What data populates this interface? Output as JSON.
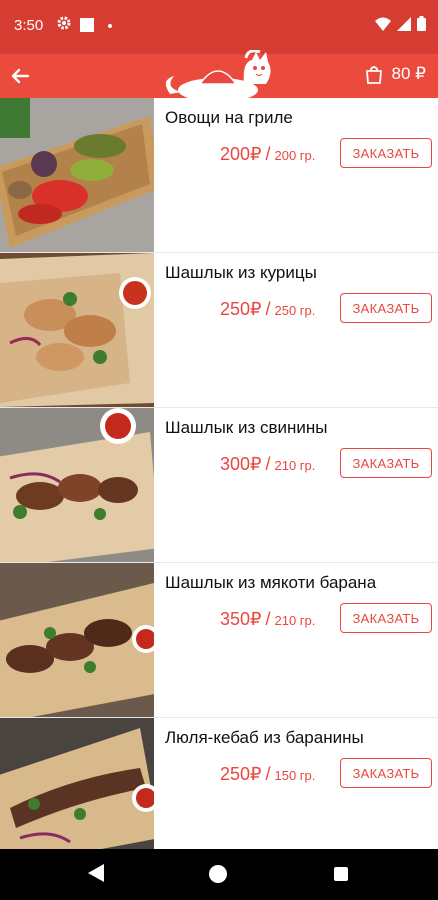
{
  "status_bar": {
    "time": "3:50"
  },
  "header": {
    "cart_total": "80 ₽",
    "icons": [
      "back-arrow-icon",
      "cat-chef-logo",
      "cart-bag-icon"
    ]
  },
  "items": [
    {
      "name": "Овощи на гриле",
      "price": "200₽",
      "weight": "200 гр.",
      "button": "ЗАКАЗАТЬ"
    },
    {
      "name": "Шашлык из курицы",
      "price": "250₽",
      "weight": "250 гр.",
      "button": "ЗАКАЗАТЬ"
    },
    {
      "name": "Шашлык из свинины",
      "price": "300₽",
      "weight": "210 гр.",
      "button": "ЗАКАЗАТЬ"
    },
    {
      "name": "Шашлык из мякоти барана",
      "price": "350₽",
      "weight": "210 гр.",
      "button": "ЗАКАЗАТЬ"
    },
    {
      "name": "Люля-кебаб из баранины",
      "price": "250₽",
      "weight": "150 гр.",
      "button": "ЗАКАЗАТЬ"
    }
  ],
  "colors": {
    "status_bar": "#d63c31",
    "app_bar": "#ea4b3c",
    "accent": "#e8483f"
  }
}
